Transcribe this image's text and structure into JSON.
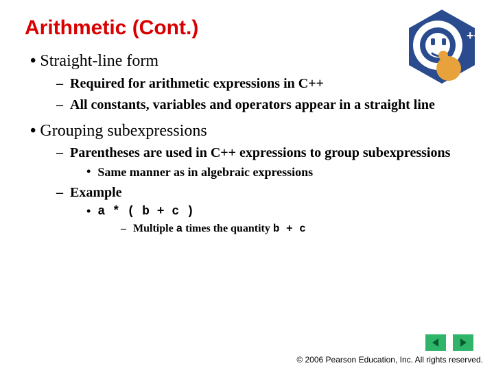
{
  "title": "Arithmetic (Cont.)",
  "logo": {
    "plus": "++"
  },
  "l1": [
    {
      "heading": "Straight-line form",
      "sub": [
        {
          "text": "Required for arithmetic expressions in C++"
        },
        {
          "text": "All constants, variables and operators appear in a straight line"
        }
      ]
    },
    {
      "heading": "Grouping subexpressions",
      "sub": [
        {
          "text": "Parentheses are used in C++ expressions to group subexpressions",
          "sub3": [
            {
              "text": "Same manner as in algebraic expressions"
            }
          ]
        },
        {
          "text": "Example",
          "sub3": [
            {
              "code": "a * ( b + c )",
              "sub4": [
                {
                  "pre": "Multiple ",
                  "code1": "a",
                  "mid": " times the quantity ",
                  "code2": "b + c"
                }
              ]
            }
          ]
        }
      ]
    }
  ],
  "footer": "© 2006 Pearson Education, Inc.  All rights reserved.",
  "nav": {
    "prev": "prev",
    "next": "next"
  }
}
